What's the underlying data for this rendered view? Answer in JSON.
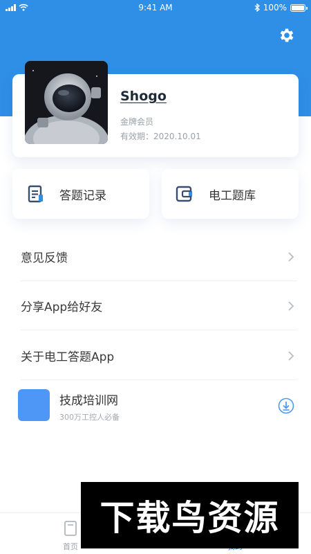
{
  "status_bar": {
    "time": "9:41 AM",
    "battery": "100%"
  },
  "header": {
    "settings_icon": "gear-icon",
    "background_color": "#2f8ee6"
  },
  "profile": {
    "name": "Shogo",
    "level": "金牌会员",
    "expiry": "有效期：2020.10.01"
  },
  "quick_actions": [
    {
      "label": "答题记录",
      "icon": "document-icon"
    },
    {
      "label": "电工题库",
      "icon": "wallet-icon"
    }
  ],
  "menu": [
    {
      "label": "意见反馈"
    },
    {
      "label": "分享App给好友"
    },
    {
      "label": "关于电工答题App"
    }
  ],
  "promo": {
    "title": "技成培训网",
    "description": "300万工控人必备",
    "logo_color": "#4f97f7"
  },
  "tabbar": {
    "tabs": [
      {
        "label": "首页"
      },
      {
        "label": "我的"
      }
    ],
    "active_color": "#2f8ee6"
  },
  "watermark": {
    "text": "下载鸟资源"
  }
}
